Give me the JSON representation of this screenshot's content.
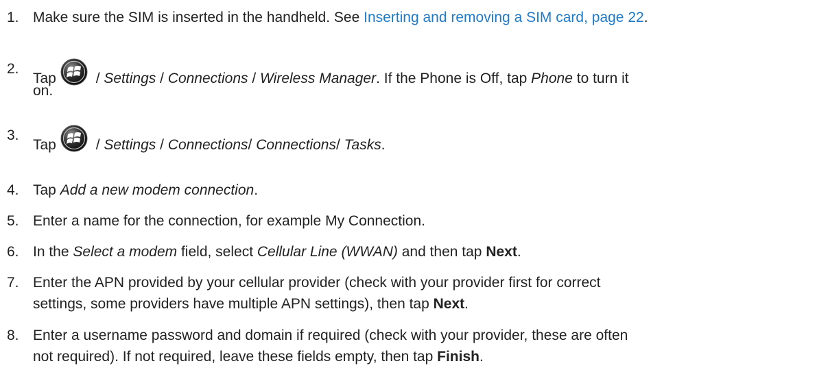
{
  "steps": [
    {
      "num": "1.",
      "t1": "Make sure the SIM is inserted in the handheld. See ",
      "link": "Inserting and removing a SIM card, page 22",
      "t2": "."
    },
    {
      "num": "2.",
      "tap": "Tap",
      "icon": "windows-start-icon",
      "s1": " / ",
      "e1": "Settings",
      "s2": " / ",
      "e2": "Connections",
      "s3": " / ",
      "e3": "Wireless Manager",
      "t4": ". If the Phone is Off, tap ",
      "e4": "Phone",
      "t5": " to turn it",
      "line2": "on."
    },
    {
      "num": "3.",
      "tap": "Tap",
      "icon": "windows-start-icon",
      "s1": " / ",
      "e1": "Settings",
      "s2": " / ",
      "e2": "Connections",
      "s3": "/ ",
      "e3": "Connections",
      "s4": "/ ",
      "e4": "Tasks",
      "t5": "."
    },
    {
      "num": "4.",
      "t1": "Tap ",
      "e1": "Add a new modem connection",
      "t2": "."
    },
    {
      "num": "5.",
      "t1": "Enter a name for the connection, for example My Connection."
    },
    {
      "num": "6.",
      "t1": "In the ",
      "e1": "Select a modem",
      "t2": " field, select ",
      "e2": "Cellular Line (WWAN)",
      "t3": " and then tap ",
      "b1": "Next",
      "t4": "."
    },
    {
      "num": "7.",
      "t1": "Enter the APN provided by your cellular provider (check with your provider first for correct",
      "line2a": "settings, some providers have multiple APN settings), then tap ",
      "b1": "Next",
      "line2b": "."
    },
    {
      "num": "8.",
      "t1": "Enter a username password and domain if required (check with your provider, these are often",
      "line2a": "not required). If not required, leave these fields empty, then tap ",
      "b1": "Finish",
      "line2b": "."
    }
  ],
  "colors": {
    "text": "#222222",
    "link": "#1f7ac8"
  }
}
